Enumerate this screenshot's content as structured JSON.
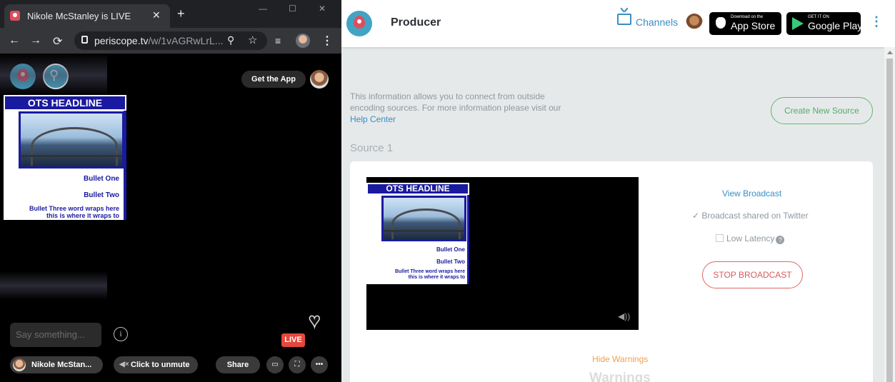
{
  "browser": {
    "tab_title": "Nikole McStanley is LIVE",
    "url_domain": "periscope.tv",
    "url_path": "/w/1vAGRwLrL..."
  },
  "viewer": {
    "get_app_label": "Get the App",
    "say_placeholder": "Say something...",
    "live_badge": "LIVE",
    "username": "Nikole McStan...",
    "unmute_label": "Click to unmute",
    "share_label": "Share"
  },
  "overlay_graphic": {
    "headline": "OTS HEADLINE",
    "bullet_one": "Bullet One",
    "bullet_two": "Bullet Two",
    "bullet_three_line1": "Bullet Three word wraps here",
    "bullet_three_line2": "this is where it wraps to",
    "colors": {
      "headline_bg": "#1a1aa0",
      "text": "#1a1aa0"
    }
  },
  "producer": {
    "header_title": "Producer",
    "channels_label": "Channels",
    "app_store_small": "Download on the",
    "app_store_big": "App Store",
    "google_play_small": "GET IT ON",
    "google_play_big": "Google Play",
    "info_text": "This information allows you to connect from outside encoding sources. For more information please visit our",
    "help_link": "Help Center",
    "create_source_label": "Create New Source",
    "source_title": "Source 1",
    "view_broadcast_label": "View Broadcast",
    "shared_twitter_label": "✓ Broadcast shared on Twitter",
    "low_latency_label": "Low Latency",
    "stop_broadcast_label": "STOP BROADCAST",
    "hide_warnings_label": "Hide Warnings",
    "warnings_title": "Warnings",
    "colors": {
      "link": "#3a8ec2",
      "create": "#56ab62",
      "stop": "#d95b5b",
      "warning": "#f0a04b"
    }
  }
}
